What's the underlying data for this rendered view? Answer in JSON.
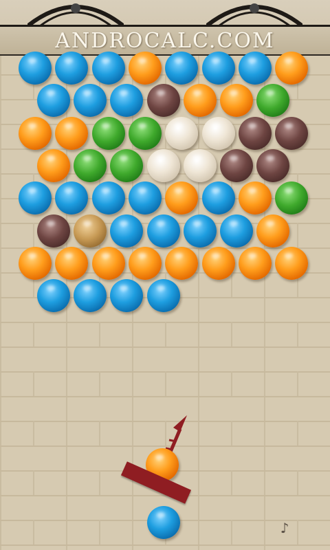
{
  "header": {
    "title": "ANDROCALC.COM"
  },
  "colors": {
    "blue": "#1e9ee0",
    "orange": "#ff9d1c",
    "green": "#3fa92c",
    "maroon": "#6e4542",
    "cream": "#efe6d6",
    "tan": "#c79a55",
    "launcher": "#8f1d22"
  },
  "grid": {
    "rows": [
      [
        "blue",
        "blue",
        "blue",
        "orange",
        "blue",
        "blue",
        "blue",
        "orange"
      ],
      [
        "blue",
        "blue",
        "blue",
        "maroon",
        "orange",
        "orange",
        "green"
      ],
      [
        "orange",
        "orange",
        "green",
        "green",
        "cream",
        "cream",
        "maroon",
        "maroon"
      ],
      [
        "orange",
        "green",
        "green",
        "cream",
        "cream",
        "maroon",
        "maroon"
      ],
      [
        "blue",
        "blue",
        "blue",
        "blue",
        "orange",
        "blue",
        "orange",
        "green"
      ],
      [
        "maroon",
        "tan",
        "blue",
        "blue",
        "blue",
        "blue",
        "orange"
      ],
      [
        "orange",
        "orange",
        "orange",
        "orange",
        "orange",
        "orange",
        "orange",
        "orange"
      ],
      [
        "blue",
        "blue",
        "blue",
        "blue"
      ]
    ]
  },
  "shooter": {
    "loaded_color": "orange",
    "next_color": "blue"
  },
  "icons": {
    "sound": "speaker-icon"
  }
}
